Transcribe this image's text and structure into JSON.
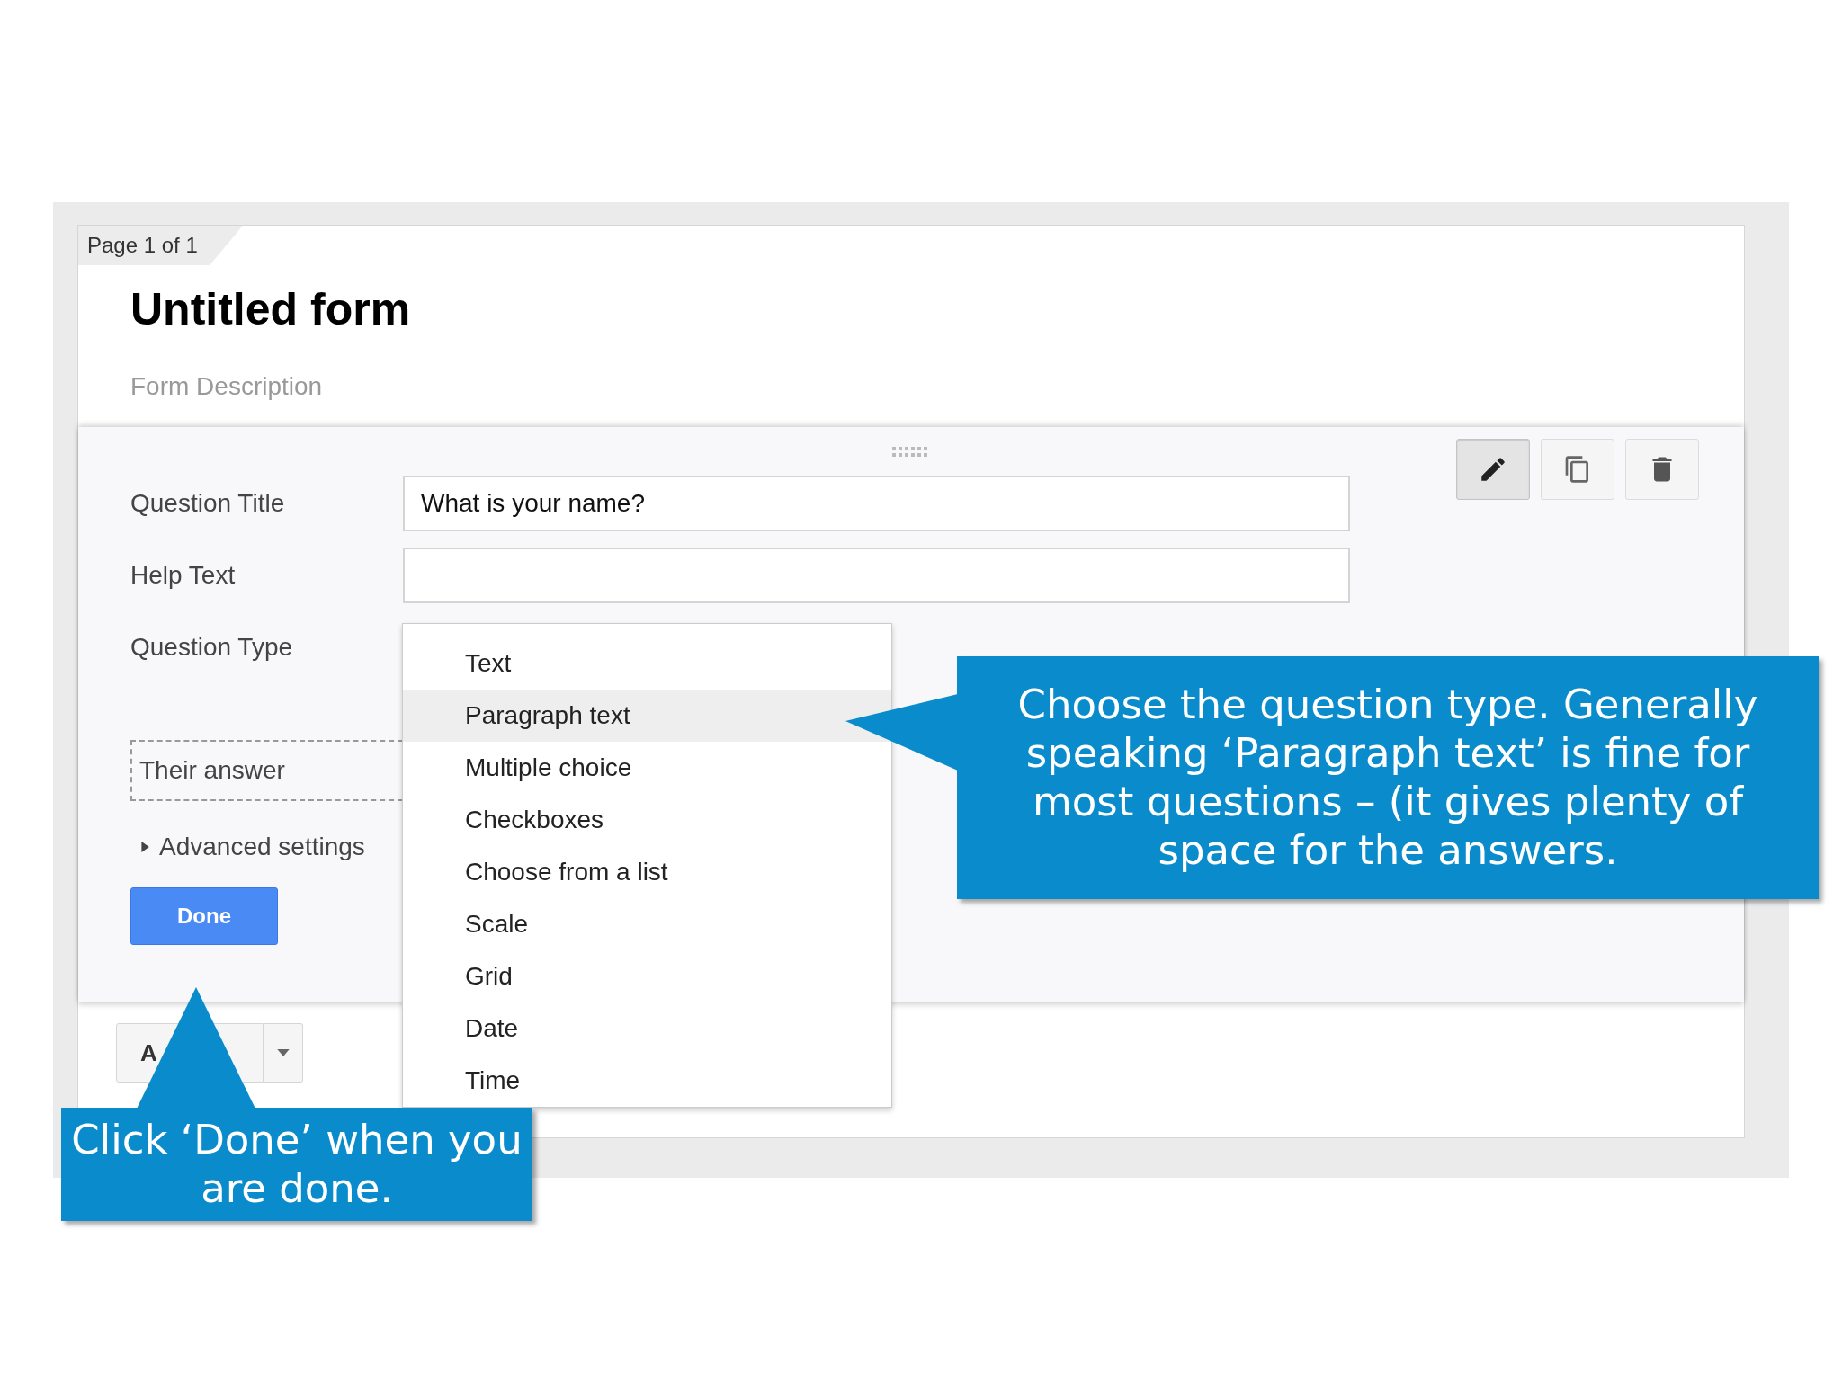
{
  "page_tab": "Page 1 of 1",
  "form": {
    "title": "Untitled form",
    "description": {
      "placeholder": "Form Description"
    }
  },
  "question": {
    "title_field": {
      "label": "Question Title",
      "value": "What is your name?"
    },
    "help_field": {
      "label": "Help Text"
    },
    "type_label": "Question Type",
    "answer_preview": "Their answer",
    "advanced": {
      "label": "Advanced settings",
      "expanded": false
    },
    "done_button": "Done",
    "toolbar": [
      {
        "kind": "edit",
        "selected": true
      },
      {
        "kind": "duplicate",
        "selected": false
      },
      {
        "kind": "delete",
        "selected": false
      }
    ]
  },
  "type_menu": [
    {
      "label": "Text",
      "selected": false
    },
    {
      "label": "Paragraph text",
      "selected": true
    },
    {
      "label": "Multiple choice",
      "selected": false
    },
    {
      "label": "Checkboxes",
      "selected": false
    },
    {
      "label": "Choose from a list",
      "selected": false
    },
    {
      "label": "Scale",
      "selected": false
    },
    {
      "label": "Grid",
      "selected": false
    },
    {
      "label": "Date",
      "selected": false
    },
    {
      "label": "Time",
      "selected": false
    }
  ],
  "add_item": {
    "label": "A"
  },
  "callouts": [
    {
      "text": "Choose the question type. Generally speaking ‘Paragraph text’ is fine for most questions – (it gives plenty of space for the answers."
    },
    {
      "text": "Click ‘Done’ when you are done."
    }
  ]
}
